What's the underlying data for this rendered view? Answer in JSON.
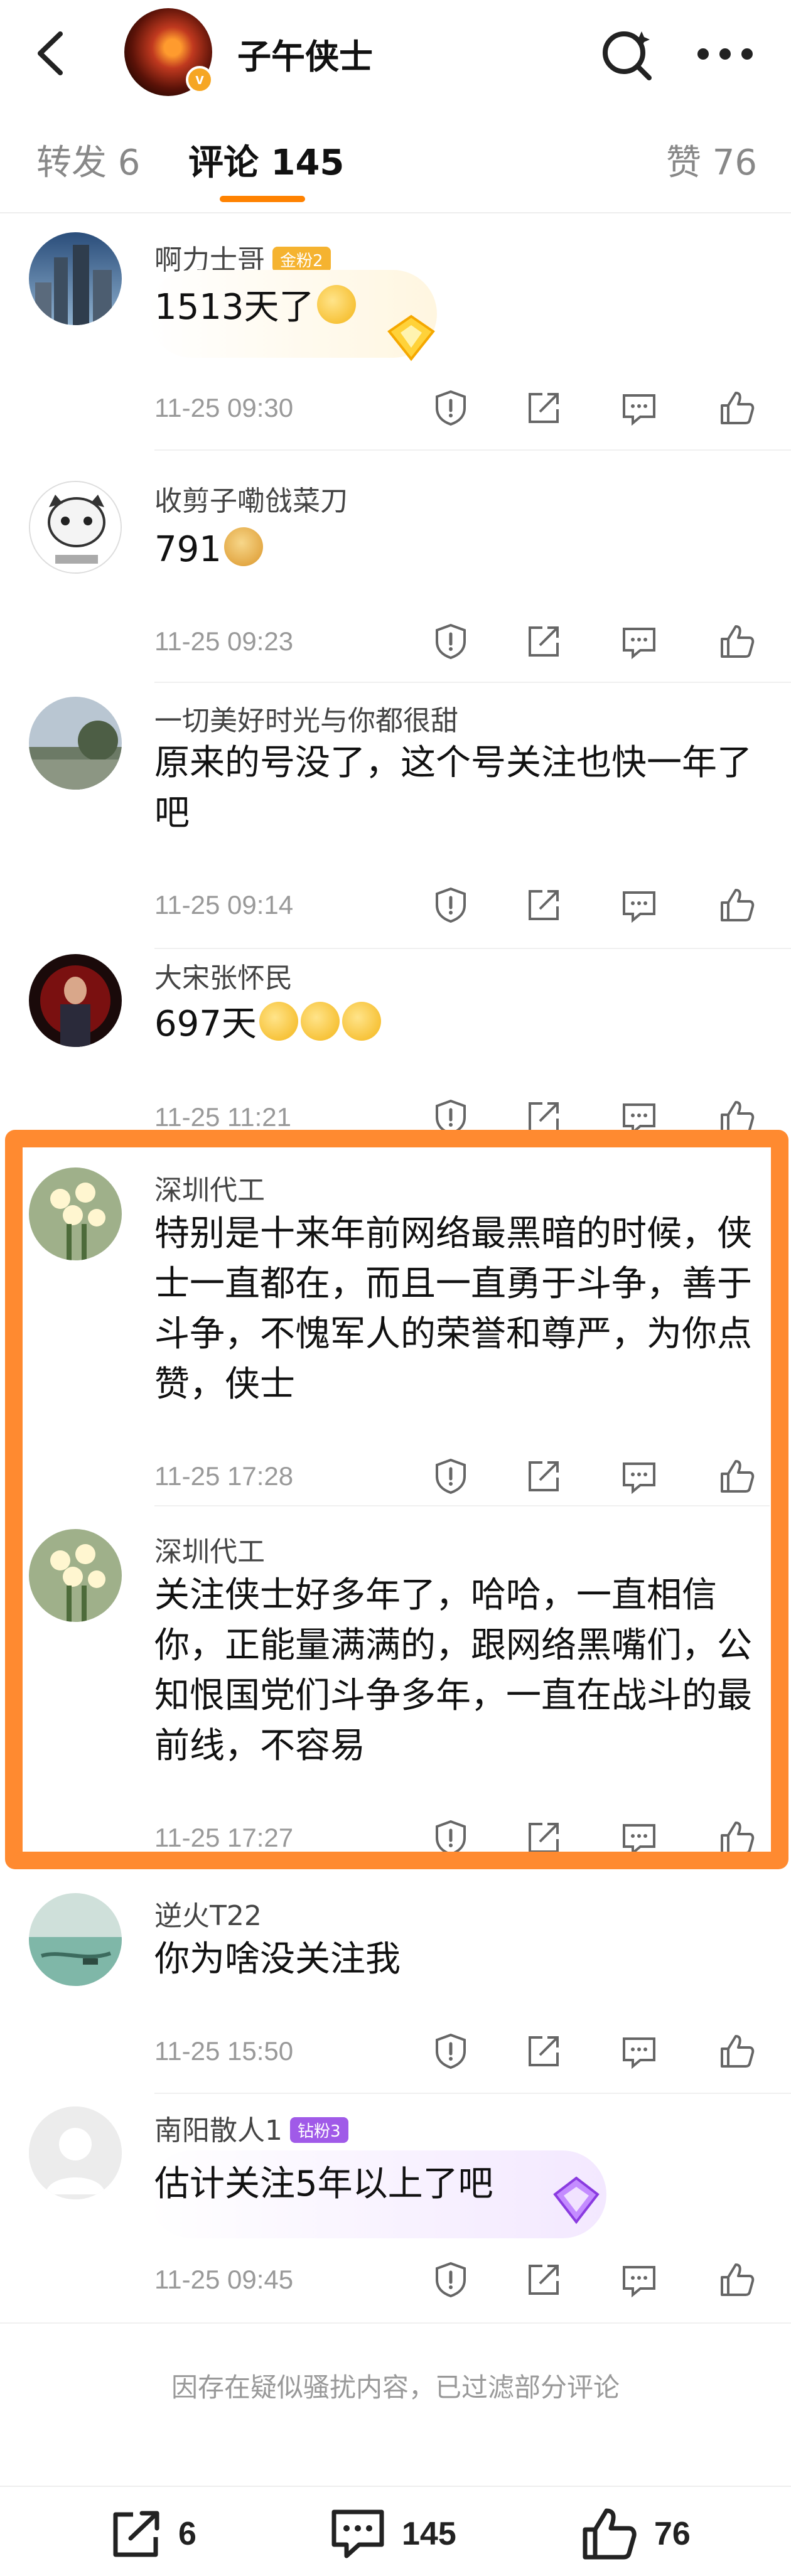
{
  "header": {
    "title": "子午侠士",
    "avatar_badge": "v"
  },
  "tabs": {
    "forward_label": "转发 6",
    "comment_label": "评论 145",
    "like_label": "赞 76",
    "active": "comment"
  },
  "comments": [
    {
      "user": "啊力士哥",
      "badge": "金粉2",
      "text": "1513天了",
      "emoji": "thinking-face",
      "time": "11-25 09:30"
    },
    {
      "user": "收剪子嘞戗菜刀",
      "text": "791",
      "emoji": "doge",
      "time": "11-25 09:23"
    },
    {
      "user": "一切美好时光与你都很甜",
      "text": "原来的号没了，这个号关注也快一年了吧",
      "time": "11-25 09:14"
    },
    {
      "user": "大宋张怀民",
      "text": "697天",
      "emoji": "666 x3",
      "time": "11-25 11:21"
    },
    {
      "user": "深圳代工",
      "text": "特别是十来年前网络最黑暗的时候，侠士一直都在，而且一直勇于斗争，善于斗争，不愧军人的荣誉和尊严，为你点赞，侠士",
      "time": "11-25 17:28"
    },
    {
      "user": "深圳代工",
      "text": "关注侠士好多年了，哈哈，一直相信你，正能量满满的，跟网络黑嘴们，公知恨国党们斗争多年，一直在战斗的最前线，不容易",
      "time": "11-25 17:27"
    },
    {
      "user": "逆火T22",
      "text": "你为啥没关注我",
      "time": "11-25 15:50"
    },
    {
      "user": "南阳散人1",
      "badge": "钻粉3",
      "text": "估计关注5年以上了吧",
      "time": "11-25 09:45"
    }
  ],
  "filter_note": "因存在疑似骚扰内容，已过滤部分评论",
  "bottom_bar": {
    "share_count": "6",
    "comment_count": "145",
    "like_count": "76"
  },
  "colors": {
    "accent": "#ff8200",
    "highlight_border": "#ff8a30",
    "gold_badge": "#f5b330",
    "diamond_badge": "#a05ae8"
  }
}
